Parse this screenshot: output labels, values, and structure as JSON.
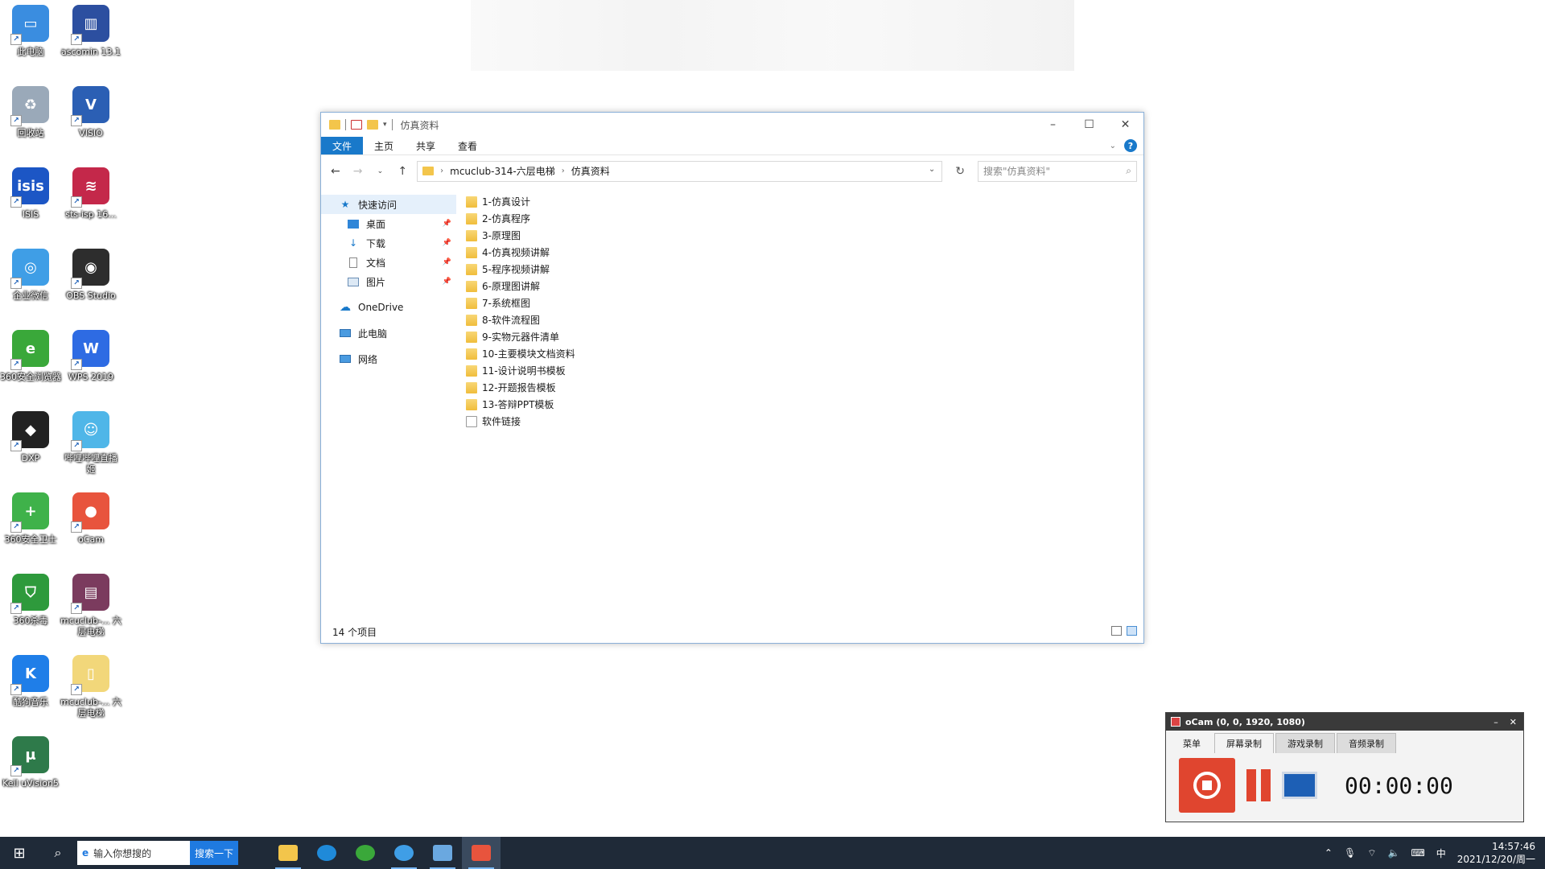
{
  "desktop": {
    "icons": [
      {
        "label": "此电脑",
        "color": "#3a8de0",
        "glyph": "▭"
      },
      {
        "label": "ascomin 13.1",
        "color": "#2c4fa0",
        "glyph": "▥"
      },
      {
        "label": "回收站",
        "color": "#9aa9b9",
        "glyph": "♻"
      },
      {
        "label": "VISIO",
        "color": "#2b5fb4",
        "glyph": "V"
      },
      {
        "label": "ISIS",
        "color": "#1c56c5",
        "glyph": "isis"
      },
      {
        "label": "sts-isp 16...",
        "color": "#c4284a",
        "glyph": "≋"
      },
      {
        "label": "企业微信",
        "color": "#3f9ee6",
        "glyph": "◎"
      },
      {
        "label": "OBS Studio",
        "color": "#2d2d2d",
        "glyph": "◉"
      },
      {
        "label": "360安全浏览器",
        "color": "#3aa83a",
        "glyph": "e"
      },
      {
        "label": "WPS 2019",
        "color": "#2e6be3",
        "glyph": "W"
      },
      {
        "label": "DXP",
        "color": "#222222",
        "glyph": "◆"
      },
      {
        "label": "哔哩哔哩直播姬",
        "color": "#4fb6e8",
        "glyph": "☺"
      },
      {
        "label": "360安全卫士",
        "color": "#3fb24a",
        "glyph": "+"
      },
      {
        "label": "oCam",
        "color": "#e8543d",
        "glyph": "●"
      },
      {
        "label": "360杀毒",
        "color": "#2e9a3c",
        "glyph": "⛉"
      },
      {
        "label": "mcuclub-... 六层电梯",
        "color": "#7b3b5e",
        "glyph": "▤"
      },
      {
        "label": "酷狗音乐",
        "color": "#1f7ee8",
        "glyph": "K"
      },
      {
        "label": "mcuclub-... 六层电梯",
        "color": "#f2d77a",
        "glyph": "▯"
      },
      {
        "label": "Keil uVision5",
        "color": "#2e7a4a",
        "glyph": "μ"
      }
    ]
  },
  "explorer": {
    "title": "仿真资料",
    "ribbon_tabs": [
      {
        "label": "文件",
        "active": true
      },
      {
        "label": "主页",
        "active": false
      },
      {
        "label": "共享",
        "active": false
      },
      {
        "label": "查看",
        "active": false
      }
    ],
    "help_label": "?",
    "breadcrumb": [
      "mcuclub-314-六层电梯",
      "仿真资料"
    ],
    "search_placeholder": "搜索\"仿真资料\"",
    "nav": {
      "quick_access": "快速访问",
      "pinned": [
        {
          "label": "桌面",
          "icon": "desktop-icon"
        },
        {
          "label": "下载",
          "icon": "download-icon"
        },
        {
          "label": "文档",
          "icon": "documents-icon"
        },
        {
          "label": "图片",
          "icon": "pictures-icon"
        }
      ],
      "onedrive": "OneDrive",
      "this_pc": "此电脑",
      "network": "网络"
    },
    "files": [
      {
        "name": "1-仿真设计",
        "type": "folder"
      },
      {
        "name": "2-仿真程序",
        "type": "folder"
      },
      {
        "name": "3-原理图",
        "type": "folder"
      },
      {
        "name": "4-仿真视频讲解",
        "type": "folder"
      },
      {
        "name": "5-程序视频讲解",
        "type": "folder"
      },
      {
        "name": "6-原理图讲解",
        "type": "folder"
      },
      {
        "name": "7-系统框图",
        "type": "folder"
      },
      {
        "name": "8-软件流程图",
        "type": "folder"
      },
      {
        "name": "9-实物元器件清单",
        "type": "folder"
      },
      {
        "name": "10-主要模块文档资料",
        "type": "folder"
      },
      {
        "name": "11-设计说明书模板",
        "type": "folder"
      },
      {
        "name": "12-开题报告模板",
        "type": "folder"
      },
      {
        "name": "13-答辩PPT模板",
        "type": "folder"
      },
      {
        "name": "软件链接",
        "type": "file"
      }
    ],
    "status": "14 个项目"
  },
  "ocam": {
    "title": "oCam (0, 0, 1920, 1080)",
    "tabs": [
      {
        "label": "菜单",
        "state": "plain"
      },
      {
        "label": "屏幕录制",
        "state": "active"
      },
      {
        "label": "游戏录制",
        "state": "inactive"
      },
      {
        "label": "音频录制",
        "state": "inactive"
      }
    ],
    "time": "00:00:00",
    "accent_color": "#e0452f"
  },
  "taskbar": {
    "search_placeholder": "输入你想搜的",
    "search_button": "搜索一下",
    "ime": "中",
    "time": "14:57:46",
    "date": "2021/12/20/周一"
  }
}
